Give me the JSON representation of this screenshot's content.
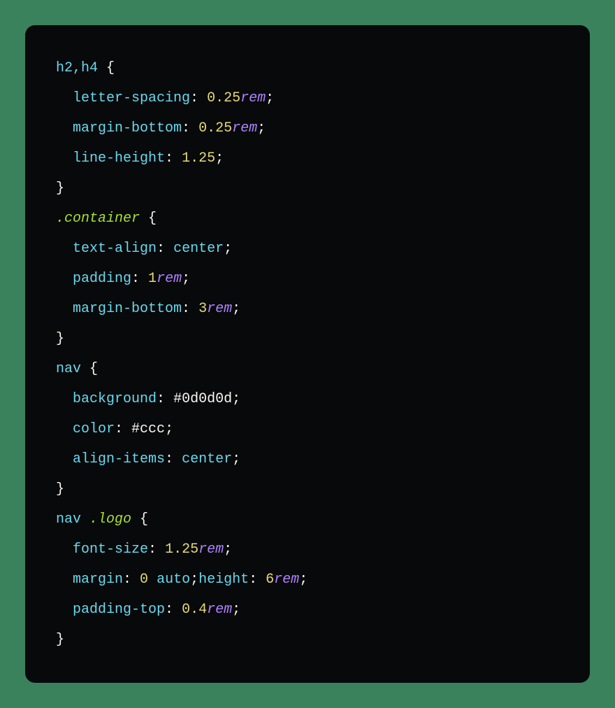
{
  "code": {
    "rules": [
      {
        "selector": "h2,h4",
        "declarations": [
          {
            "property": "letter-spacing",
            "value_num": "0.25",
            "value_unit": "rem"
          },
          {
            "property": "margin-bottom",
            "value_num": "0.25",
            "value_unit": "rem"
          },
          {
            "property": "line-height",
            "value_num": "1.25",
            "value_unit": ""
          }
        ]
      },
      {
        "selector": ".container",
        "declarations": [
          {
            "property": "text-align",
            "value_kw": "center"
          },
          {
            "property": "padding",
            "value_num": "1",
            "value_unit": "rem"
          },
          {
            "property": "margin-bottom",
            "value_num": "3",
            "value_unit": "rem"
          }
        ]
      },
      {
        "selector": "nav",
        "declarations": [
          {
            "property": "background",
            "value_hex": "#0d0d0d"
          },
          {
            "property": "color",
            "value_hex": "#ccc"
          },
          {
            "property": "align-items",
            "value_kw": "center"
          }
        ]
      },
      {
        "selector": "nav .logo",
        "declarations": [
          {
            "property": "font-size",
            "value_num": "1.25",
            "value_unit": "rem"
          },
          {
            "property": "margin",
            "value_raw": "0 auto",
            "inline_next": {
              "property": "height",
              "value_num": "6",
              "value_unit": "rem"
            }
          },
          {
            "property": "padding-top",
            "value_num": "0.4",
            "value_unit": "rem"
          }
        ]
      }
    ]
  },
  "tokens": {
    "open_brace": "{",
    "close_brace": "}",
    "colon": ":",
    "semicolon": ";",
    "space": " "
  }
}
